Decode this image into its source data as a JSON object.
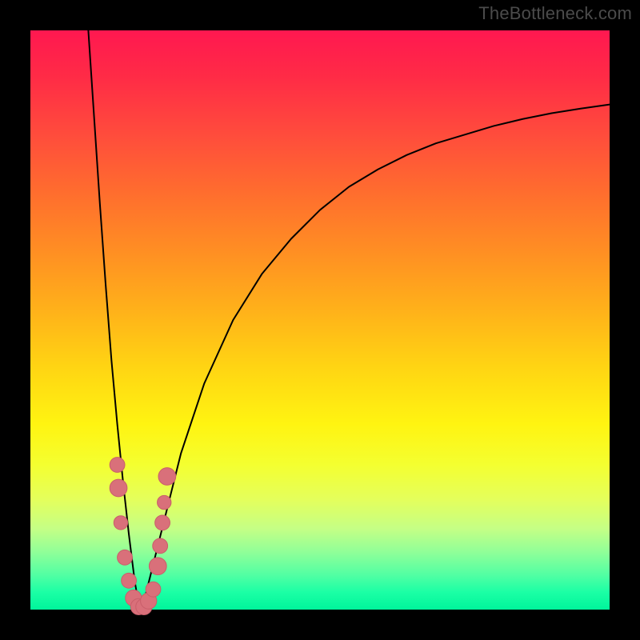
{
  "watermark": "TheBottleneck.com",
  "colors": {
    "marker_fill": "#d9707a",
    "marker_stroke": "#c95e6a",
    "curve_stroke": "#000000",
    "background_black": "#000000",
    "gradient_top": "#ff1850",
    "gradient_bottom": "#00f59b"
  },
  "chart_data": {
    "type": "line",
    "title": "",
    "xlabel": "",
    "ylabel": "",
    "xlim": [
      0,
      100
    ],
    "ylim": [
      0,
      100
    ],
    "grid": false,
    "legend": false,
    "annotations": [
      "TheBottleneck.com"
    ],
    "description": "Bottleneck-style V-shaped curve over a vertical red-to-green gradient. The curve descends from the top-left edge, reaches a minimum near x≈19 at y≈0, then rises asymptotically toward the right. A cluster of salmon-colored markers sits around the minimum of the V.",
    "series": [
      {
        "name": "left-branch",
        "x": [
          10,
          11,
          12,
          13,
          14,
          15,
          16,
          17,
          17.5,
          18,
          18.5,
          19
        ],
        "y": [
          100,
          85,
          70,
          56,
          43,
          32,
          22,
          13,
          9,
          5,
          2,
          0
        ]
      },
      {
        "name": "right-branch",
        "x": [
          19,
          20,
          21,
          22,
          24,
          26,
          28,
          30,
          35,
          40,
          45,
          50,
          55,
          60,
          65,
          70,
          75,
          80,
          85,
          90,
          95,
          100
        ],
        "y": [
          0,
          3,
          7,
          11,
          19,
          27,
          33,
          39,
          50,
          58,
          64,
          69,
          73,
          76,
          78.5,
          80.5,
          82,
          83.5,
          84.7,
          85.7,
          86.5,
          87.2
        ]
      }
    ],
    "markers": [
      {
        "x": 15.0,
        "y": 25,
        "r": 1.3
      },
      {
        "x": 15.2,
        "y": 21,
        "r": 1.5
      },
      {
        "x": 15.6,
        "y": 15,
        "r": 1.2
      },
      {
        "x": 16.3,
        "y": 9,
        "r": 1.3
      },
      {
        "x": 17.0,
        "y": 5,
        "r": 1.3
      },
      {
        "x": 17.8,
        "y": 2,
        "r": 1.4
      },
      {
        "x": 18.7,
        "y": 0.5,
        "r": 1.4
      },
      {
        "x": 19.6,
        "y": 0.5,
        "r": 1.4
      },
      {
        "x": 20.4,
        "y": 1.5,
        "r": 1.4
      },
      {
        "x": 21.2,
        "y": 3.5,
        "r": 1.3
      },
      {
        "x": 22.0,
        "y": 7.5,
        "r": 1.5
      },
      {
        "x": 22.4,
        "y": 11,
        "r": 1.3
      },
      {
        "x": 22.8,
        "y": 15,
        "r": 1.3
      },
      {
        "x": 23.1,
        "y": 18.5,
        "r": 1.2
      },
      {
        "x": 23.6,
        "y": 23,
        "r": 1.5
      }
    ]
  }
}
